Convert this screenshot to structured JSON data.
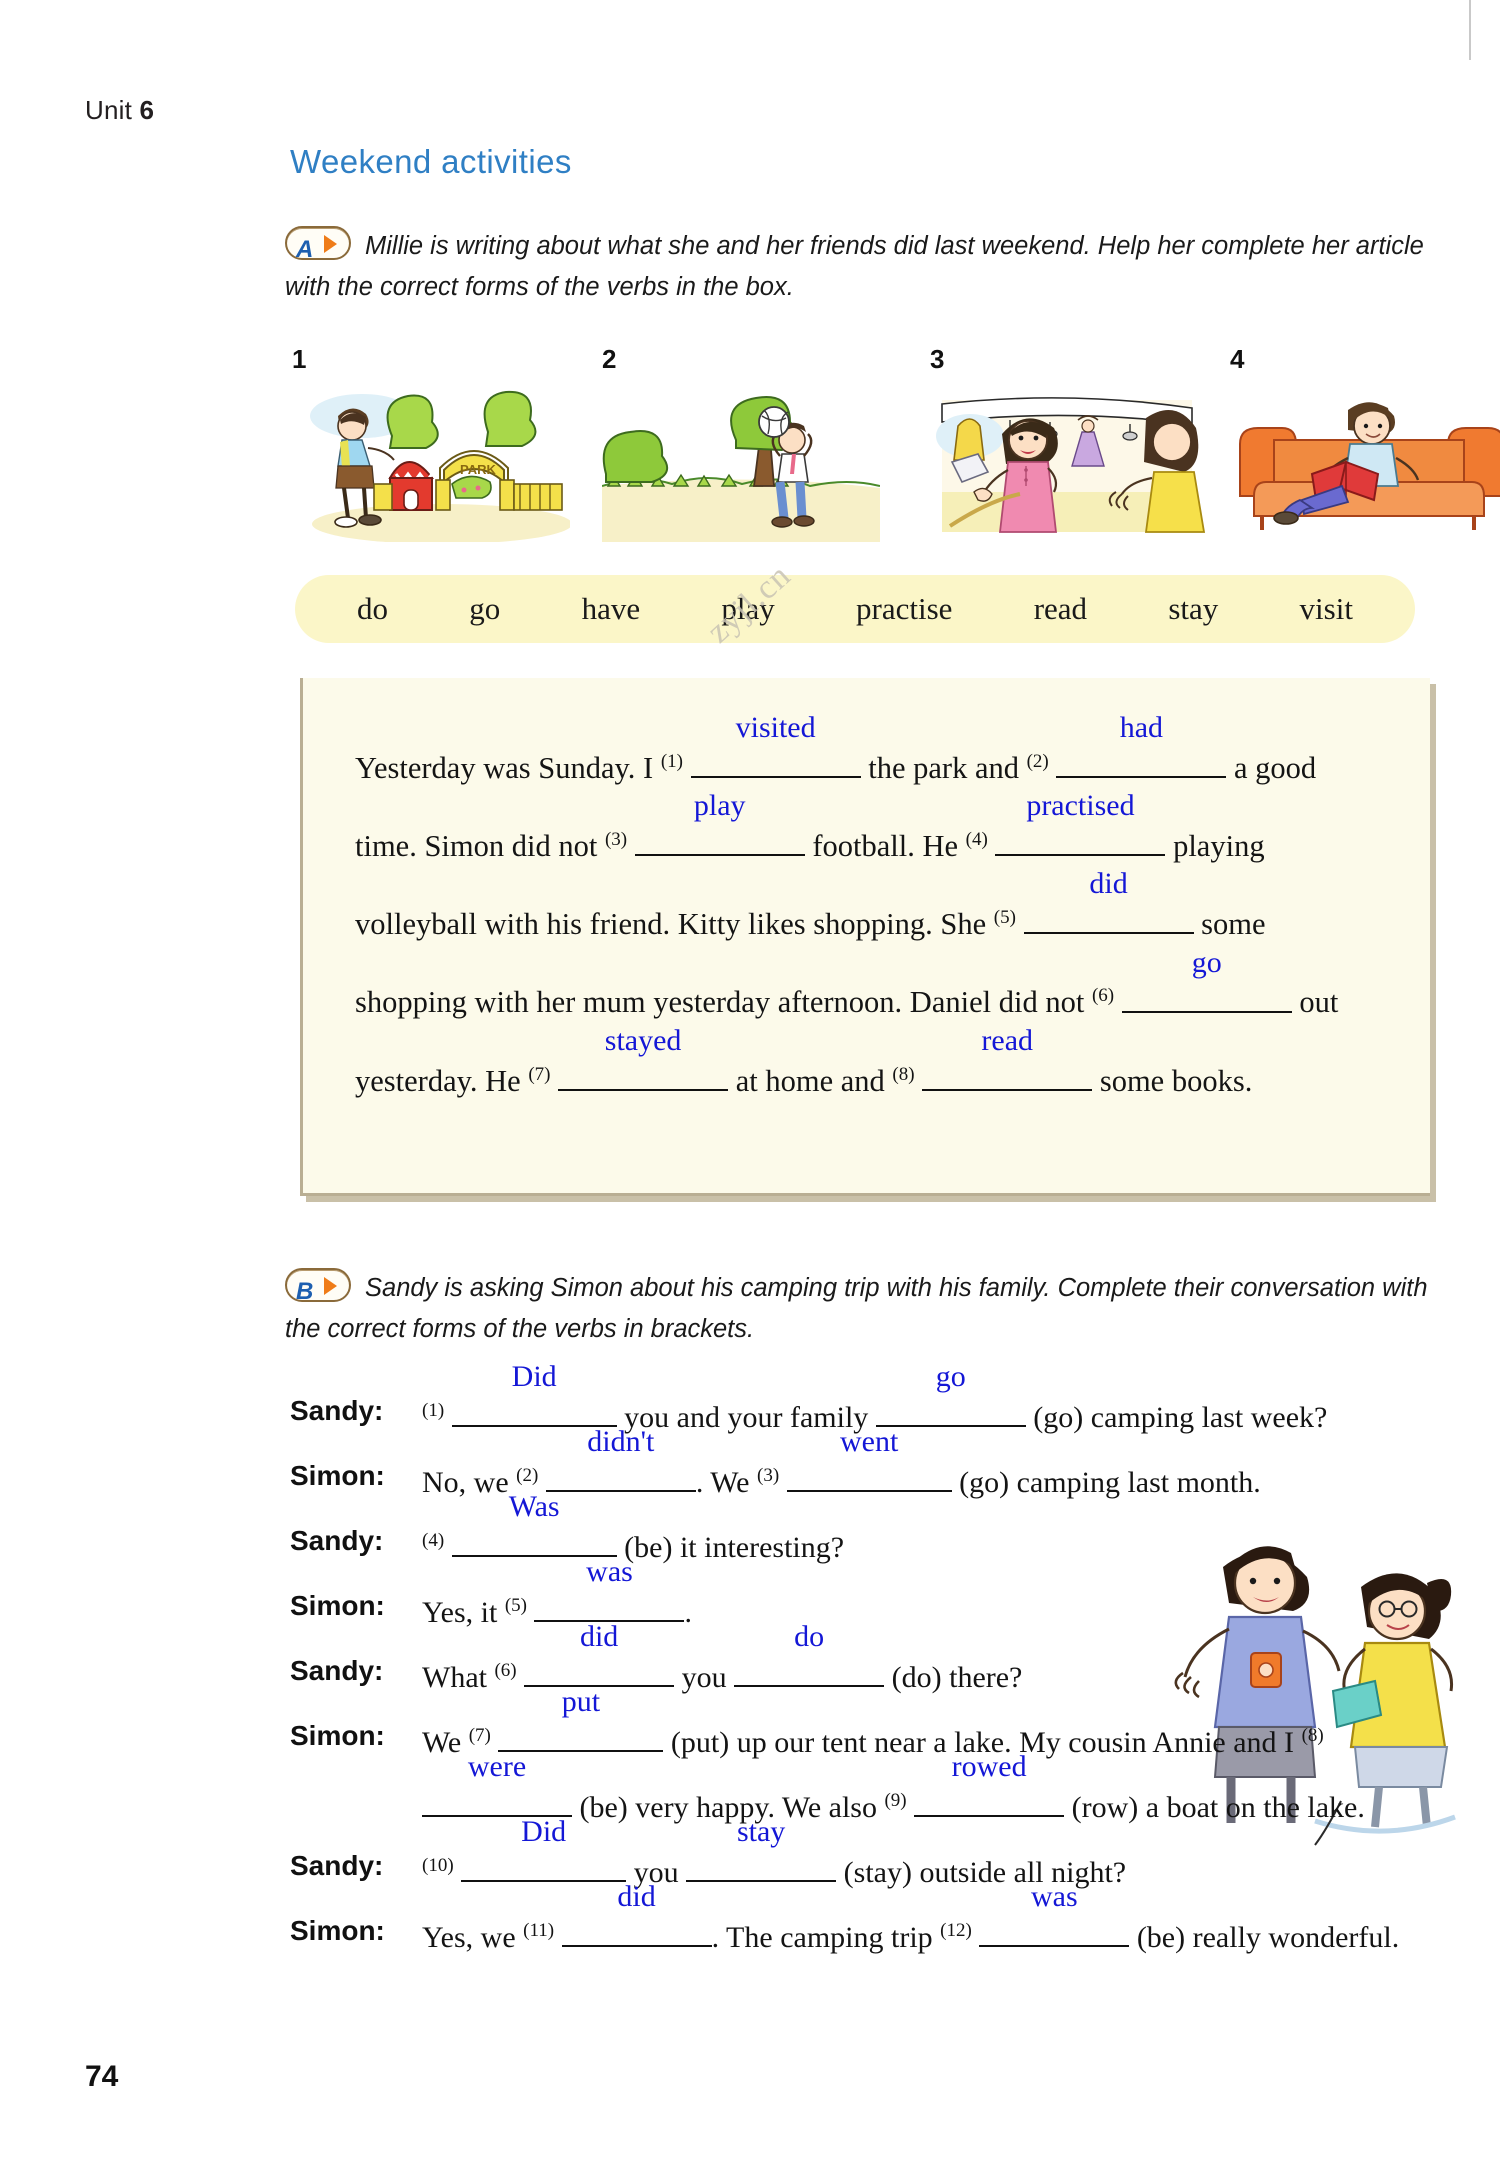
{
  "header": {
    "unit_label": "Unit",
    "unit_number": "6",
    "section_title": "Weekend activities"
  },
  "watermark": "zyjl.cn",
  "page_number": "74",
  "task_a": {
    "badge_letter": "A",
    "instruction": "Millie is writing about what she and her friends did last weekend. Help her complete her article with the correct forms of the verbs in the box.",
    "picture_numbers": [
      "1",
      "2",
      "3",
      "4"
    ],
    "picture_captions": [
      "girl walking into a park with PARK gate",
      "boy throwing a volleyball on grass",
      "two girls shopping in a clothes shop",
      "boy reading a red book on an orange sofa"
    ],
    "word_bank": [
      "do",
      "go",
      "have",
      "play",
      "practise",
      "read",
      "stay",
      "visit"
    ],
    "article": {
      "t1": "Yesterday was Sunday. I ",
      "n1": "(1)",
      "a1": "visited",
      "t2": " the park and ",
      "n2": "(2)",
      "a2": "had",
      "t3": " a good time. Simon did not ",
      "n3": "(3)",
      "a3": "play",
      "t4": " football. He ",
      "n4": "(4)",
      "a4": "practised",
      "t5": " playing volleyball with his friend. Kitty likes shopping. She ",
      "n5": "(5)",
      "a5": "did",
      "t6": " some shopping with her mum yesterday afternoon. Daniel did not ",
      "n6": "(6)",
      "a6": "go",
      "t7": " out yesterday. He ",
      "n7": "(7)",
      "a7": "stayed",
      "t8": " at home and ",
      "n8": "(8)",
      "a8": "read",
      "t9": " some books."
    }
  },
  "task_b": {
    "badge_letter": "B",
    "instruction": "Sandy is asking Simon about his camping trip with his family. Complete their conversation with the correct forms of the verbs in brackets.",
    "illustration_caption": "boy talking with a girl holding a book",
    "turns": [
      {
        "speaker": "Sandy:",
        "parts": [
          {
            "type": "sup",
            "text": "(1)"
          },
          {
            "type": "blank",
            "answer": "Did",
            "width": "w-lg"
          },
          {
            "type": "text",
            "text": " you and your family "
          },
          {
            "type": "blank",
            "answer": "go",
            "width": ""
          },
          {
            "type": "text",
            "text": " (go) camping last week?"
          }
        ]
      },
      {
        "speaker": "Simon:",
        "parts": [
          {
            "type": "text",
            "text": "No, we "
          },
          {
            "type": "sup",
            "text": "(2)"
          },
          {
            "type": "blank",
            "answer": "didn't",
            "width": ""
          },
          {
            "type": "text",
            "text": ". We "
          },
          {
            "type": "sup",
            "text": "(3)"
          },
          {
            "type": "blank",
            "answer": "went",
            "width": "w-lg"
          },
          {
            "type": "text",
            "text": " (go) camping last month."
          }
        ]
      },
      {
        "speaker": "Sandy:",
        "parts": [
          {
            "type": "sup",
            "text": "(4)"
          },
          {
            "type": "blank",
            "answer": "Was",
            "width": "w-lg"
          },
          {
            "type": "text",
            "text": " (be) it interesting?"
          }
        ]
      },
      {
        "speaker": "Simon:",
        "parts": [
          {
            "type": "text",
            "text": "Yes, it "
          },
          {
            "type": "sup",
            "text": "(5)"
          },
          {
            "type": "blank",
            "answer": "was",
            "width": ""
          },
          {
            "type": "text",
            "text": "."
          }
        ]
      },
      {
        "speaker": "Sandy:",
        "parts": [
          {
            "type": "text",
            "text": "What "
          },
          {
            "type": "sup",
            "text": "(6)"
          },
          {
            "type": "blank",
            "answer": "did",
            "width": ""
          },
          {
            "type": "text",
            "text": " you "
          },
          {
            "type": "blank",
            "answer": "do",
            "width": ""
          },
          {
            "type": "text",
            "text": " (do) there?"
          }
        ]
      },
      {
        "speaker": "Simon:",
        "parts": [
          {
            "type": "text",
            "text": "We "
          },
          {
            "type": "sup",
            "text": "(7)"
          },
          {
            "type": "blank",
            "answer": "put",
            "width": "w-lg"
          },
          {
            "type": "text",
            "text": " (put) up our tent near a lake. My cousin Annie and I "
          },
          {
            "type": "sup",
            "text": "(8)"
          },
          {
            "type": "blank",
            "answer": "were",
            "width": ""
          },
          {
            "type": "text",
            "text": " (be) very happy. We also "
          },
          {
            "type": "sup",
            "text": "(9)"
          },
          {
            "type": "blank",
            "answer": "rowed",
            "width": ""
          },
          {
            "type": "text",
            "text": " (row) a boat on the lake."
          }
        ]
      },
      {
        "speaker": "Sandy:",
        "parts": [
          {
            "type": "sup",
            "text": "(10)"
          },
          {
            "type": "blank",
            "answer": "Did",
            "width": "w-lg"
          },
          {
            "type": "text",
            "text": " you "
          },
          {
            "type": "blank",
            "answer": "stay",
            "width": ""
          },
          {
            "type": "text",
            "text": " (stay) outside all night?"
          }
        ]
      },
      {
        "speaker": "Simon:",
        "parts": [
          {
            "type": "text",
            "text": "Yes, we "
          },
          {
            "type": "sup",
            "text": "(11)"
          },
          {
            "type": "blank",
            "answer": "did",
            "width": ""
          },
          {
            "type": "text",
            "text": ". The camping trip "
          },
          {
            "type": "sup",
            "text": "(12)"
          },
          {
            "type": "blank",
            "answer": "was",
            "width": ""
          },
          {
            "type": "text",
            "text": " (be) really wonderful."
          }
        ]
      }
    ]
  },
  "colors": {
    "answer_blue": "#1417d6",
    "title_blue": "#2f7fc4",
    "badge_orange": "#ef7c18",
    "wordbank_yellow": "#fbf6c8",
    "article_cream": "#fcfaea"
  }
}
